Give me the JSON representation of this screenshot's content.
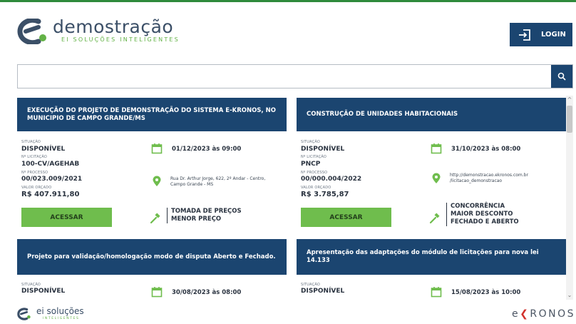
{
  "header": {
    "brand_name": "demostração",
    "brand_tagline": "EI SOLUÇÕES INTELIGENTES",
    "login_label": "LOGIN"
  },
  "search": {
    "value": "",
    "placeholder": ""
  },
  "cards": [
    {
      "title": "EXECUÇÃO DO PROJETO DE DEMONSTRAÇÃO DO SISTEMA E-KRONOS, NO MUNICIPIO DE CAMPO GRANDE/MS",
      "situacao_label": "SITUAÇÃO",
      "situacao": "DISPONÍVEL",
      "licitacao_label": "Nº LICITAÇÃO",
      "licitacao": "100-CV/AGEHAB",
      "processo_label": "Nº PROCESSO",
      "processo": "00/023.009/2021",
      "valor_label": "VALOR ORÇADO",
      "valor": "R$ 407.911,80",
      "date": "01/12/2023 às 09:00",
      "location": "Rua Dr. Arthur Jorge, 622, 2º Andar - Centro, Campo Grande - MS",
      "modalidade": [
        "TOMADA DE PREÇOS",
        "MENOR PREÇO"
      ],
      "button": "ACESSAR"
    },
    {
      "title": "CONSTRUÇÃO DE UNIDADES HABITACIONAIS",
      "situacao_label": "SITUAÇÃO",
      "situacao": "DISPONÍVEL",
      "licitacao_label": "Nº LICITAÇÃO",
      "licitacao": "PNCP",
      "processo_label": "Nº PROCESSO",
      "processo": "00/000.004/2022",
      "valor_label": "VALOR ORÇADO",
      "valor": "R$ 3.785,87",
      "date": "31/10/2023 às 08:00",
      "location": "http://demonstracao.ekronos.com.br /licitacao_demonstracao",
      "modalidade": [
        "CONCORRÊNCIA",
        "MAIOR DESCONTO",
        "FECHADO E ABERTO"
      ],
      "button": "ACESSAR"
    },
    {
      "title": "Projeto para validação/homologação modo de disputa Aberto e Fechado.",
      "situacao_label": "SITUAÇÃO",
      "situacao": "DISPONÍVEL",
      "date": "30/08/2023 às 08:00"
    },
    {
      "title": "Apresentação das adaptações do módulo de licitações para nova lei 14.133",
      "situacao_label": "SITUAÇÃO",
      "situacao": "DISPONÍVEL",
      "date": "15/08/2023 às 10:00"
    }
  ],
  "footer": {
    "brand": "ei soluções",
    "tagline": "INTELIGENTES",
    "ekronos_e": "e",
    "ekronos_rest": "RONOS"
  },
  "colors": {
    "primary": "#1b4570",
    "accent_green": "#6fbd4d",
    "brand_green": "#63b246"
  }
}
